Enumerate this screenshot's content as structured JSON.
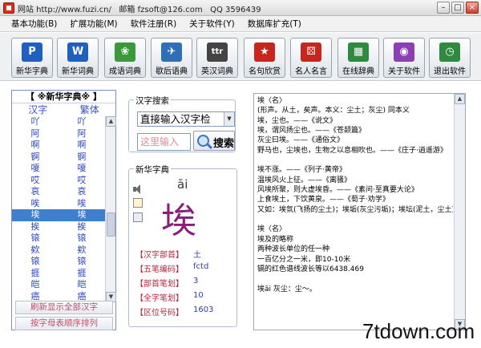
{
  "window": {
    "title": "网站 http://www.fuzi.cn/   邮箱 fzsoft@126.com   QQ 3596439",
    "minimize": "–",
    "maximize": "□",
    "close": "×"
  },
  "menu": [
    "基本功能(B)",
    "扩展功能(M)",
    "软件注册(R)",
    "关于软件(Y)",
    "数据库扩充(T)"
  ],
  "toolbar": [
    {
      "label": "新华字典",
      "icon": "P",
      "color": "#1f5fbf"
    },
    {
      "label": "新华词典",
      "icon": "W",
      "color": "#1f5fbf"
    },
    {
      "label": "成语词典",
      "icon": "❀",
      "color": "#3a9a3a"
    },
    {
      "label": "歇后语典",
      "icon": "✈",
      "color": "#2f6fb5"
    },
    {
      "label": "英汉词典",
      "icon": "ttr",
      "color": "#444444"
    },
    {
      "label": "名句欣赏",
      "icon": "★",
      "color": "#c8261c"
    },
    {
      "label": "名人名言",
      "icon": "⚄",
      "color": "#c8261c"
    },
    {
      "label": "在线辞典",
      "icon": "▦",
      "color": "#2f8a3f"
    },
    {
      "label": "关于软件",
      "icon": "◉",
      "color": "#8a3fb5"
    },
    {
      "label": "退出软件",
      "icon": "◷",
      "color": "#2f8a3f"
    }
  ],
  "left_panel": {
    "title": "【 ※新华字典※ 】",
    "col_simplified": "汉字",
    "col_traditional": "繁体",
    "rows": [
      [
        "吖",
        "吖"
      ],
      [
        "阿",
        "阿"
      ],
      [
        "啊",
        "啊"
      ],
      [
        "锕",
        "锕"
      ],
      [
        "嗄",
        "嗄"
      ],
      [
        "哎",
        "哎"
      ],
      [
        "哀",
        "哀"
      ],
      [
        "唉",
        "唉"
      ],
      [
        "埃",
        "埃"
      ],
      [
        "挨",
        "挨"
      ],
      [
        "锿",
        "锿"
      ],
      [
        "欸",
        "欸"
      ],
      [
        "锿",
        "锿"
      ],
      [
        "捱",
        "捱"
      ],
      [
        "皑",
        "皑"
      ],
      [
        "癌",
        "癌"
      ]
    ],
    "selected_index": 8,
    "btn_refresh": "刷新显示全部汉字",
    "btn_sort": "按字母表顺序排列"
  },
  "search": {
    "group_label": "汉字搜索",
    "mode": "直接输入汉字检",
    "placeholder": "这里输入",
    "button": "搜索"
  },
  "dictionary": {
    "group_label": "新华字典",
    "pinyin": "āi",
    "character": "埃",
    "fields": [
      {
        "key": "【汉字部首】",
        "value": "土"
      },
      {
        "key": "【五笔编码】",
        "value": "fctd"
      },
      {
        "key": "【部首笔划】",
        "value": "3"
      },
      {
        "key": "【全字笔划】",
        "value": "10"
      },
      {
        "key": "【区位号码】",
        "value": "1603"
      }
    ]
  },
  "definition": [
    "埃〈名〉",
    "(形声。从土，矣声。本义：尘土；灰尘) 同本义",
    "埃，尘也。——《说文》",
    "埃，谓风扬尘也。——《苍颉篇》",
    "灰尘曰埃。——《通俗文》",
    "野马也，尘埃也，生物之以息相吹也。——《庄子·逍遥游》",
    "",
    "埃不涨。——《列子·黄帝》",
    "温埃风火上征。——《离骚》",
    "风埃所聚，则大虚埃昏。——《素问·至真要大论》",
    "上食埃土，下饮黄泉。——《荀子·劝学》",
    "又如：埃氛(飞扬的尘土)；埃垢(灰尘污垢)；埃坛(泥土，尘土)",
    "",
    "埃〈名〉",
    "埃及的略称",
    "两种波长单位的任一种",
    "一百亿分之一米，即10-10米",
    "镉的红色谱线波长等以6438.469",
    "",
    "埃āi  灰尘：尘～。"
  ],
  "watermark": "7tdown.com"
}
